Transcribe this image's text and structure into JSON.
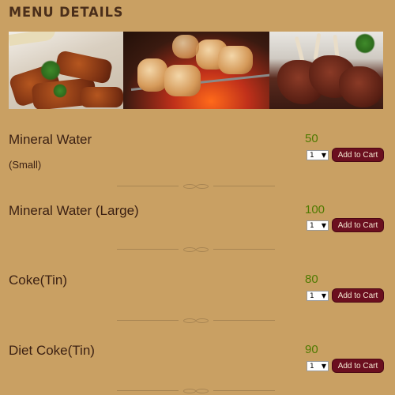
{
  "page": {
    "title": "MENU DETAILS"
  },
  "banner": {
    "image_name": "grilled-food-banner"
  },
  "items": [
    {
      "name": " Mineral Water",
      "sub": "(Small)",
      "price": "50",
      "qty": "1",
      "cart_label": "Add to Cart"
    },
    {
      "name": "Mineral Water (Large)",
      "sub": "",
      "price": "100",
      "qty": "1",
      "cart_label": "Add to Cart"
    },
    {
      "name": "Coke(Tin)",
      "sub": "",
      "price": "80",
      "qty": "1",
      "cart_label": "Add to Cart"
    },
    {
      "name": "Diet Coke(Tin)",
      "sub": "",
      "price": "90",
      "qty": "1",
      "cart_label": "Add to Cart"
    }
  ],
  "icons": {
    "dropdown": "chevron-down-icon",
    "divider": "ornament-divider-icon"
  },
  "colors": {
    "background": "#c9a063",
    "title": "#4a2e1a",
    "price": "#4f7a00",
    "button": "#6b0f1f",
    "button_text": "#f4e7d2"
  }
}
